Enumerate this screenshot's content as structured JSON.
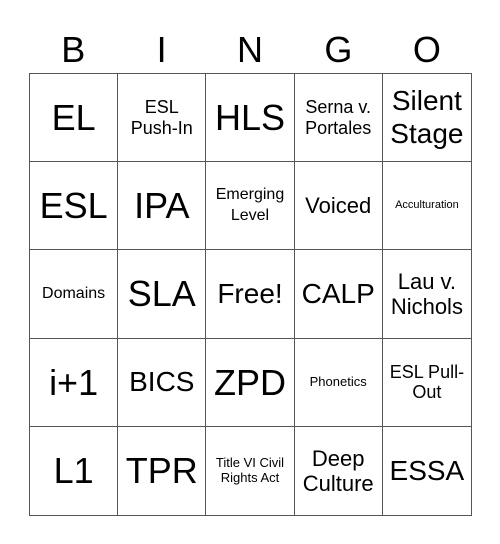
{
  "title_letters": [
    "B",
    "I",
    "N",
    "G",
    "O"
  ],
  "cells": [
    {
      "text": "EL",
      "size": "xl"
    },
    {
      "text": "ESL Push-In",
      "size": "sm"
    },
    {
      "text": "HLS",
      "size": "xl"
    },
    {
      "text": "Serna v. Portales",
      "size": "sm"
    },
    {
      "text": "Silent Stage",
      "size": "lg"
    },
    {
      "text": "ESL",
      "size": "xl"
    },
    {
      "text": "IPA",
      "size": "xl"
    },
    {
      "text": "Emerging Level",
      "size": "xs"
    },
    {
      "text": "Voiced",
      "size": "md"
    },
    {
      "text": "Acculturation",
      "size": "tiny"
    },
    {
      "text": "Domains",
      "size": "xs"
    },
    {
      "text": "SLA",
      "size": "xl"
    },
    {
      "text": "Free!",
      "size": "lg"
    },
    {
      "text": "CALP",
      "size": "lg"
    },
    {
      "text": "Lau v. Nichols",
      "size": "md"
    },
    {
      "text": "i+1",
      "size": "xl"
    },
    {
      "text": "BICS",
      "size": "lg"
    },
    {
      "text": "ZPD",
      "size": "xl"
    },
    {
      "text": "Phonetics",
      "size": "xxs"
    },
    {
      "text": "ESL Pull-Out",
      "size": "sm"
    },
    {
      "text": "L1",
      "size": "xl"
    },
    {
      "text": "TPR",
      "size": "xl"
    },
    {
      "text": "Title VI Civil Rights Act",
      "size": "xxs"
    },
    {
      "text": "Deep Culture",
      "size": "md"
    },
    {
      "text": "ESSA",
      "size": "lg"
    }
  ]
}
